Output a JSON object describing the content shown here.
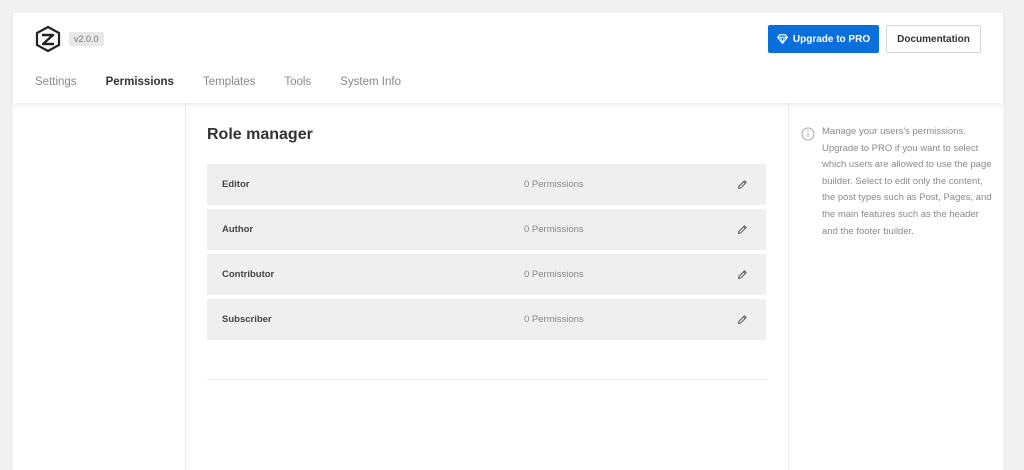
{
  "header": {
    "version": "v2.0.0",
    "upgrade_label": "Upgrade to PRO",
    "documentation_label": "Documentation"
  },
  "tabs": [
    {
      "label": "Settings",
      "active": false
    },
    {
      "label": "Permissions",
      "active": true
    },
    {
      "label": "Templates",
      "active": false
    },
    {
      "label": "Tools",
      "active": false
    },
    {
      "label": "System Info",
      "active": false
    }
  ],
  "main": {
    "title": "Role manager",
    "roles": [
      {
        "name": "Editor",
        "permissions": "0 Permissions"
      },
      {
        "name": "Author",
        "permissions": "0 Permissions"
      },
      {
        "name": "Contributor",
        "permissions": "0 Permissions"
      },
      {
        "name": "Subscriber",
        "permissions": "0 Permissions"
      }
    ]
  },
  "sidebar": {
    "info": "Manage your users's permissions. Upgrade to PRO if you want to select which users are allowed to use the page builder. Select to edit only the content, the post types such as Post, Pages, and the main features such as the header and the footer builder."
  },
  "colors": {
    "accent": "#0a6fdb",
    "row_bg": "#efefef",
    "page_bg": "#f1f1f1"
  },
  "icons": [
    "logo-icon",
    "diamond-icon",
    "pencil-icon",
    "info-icon"
  ]
}
